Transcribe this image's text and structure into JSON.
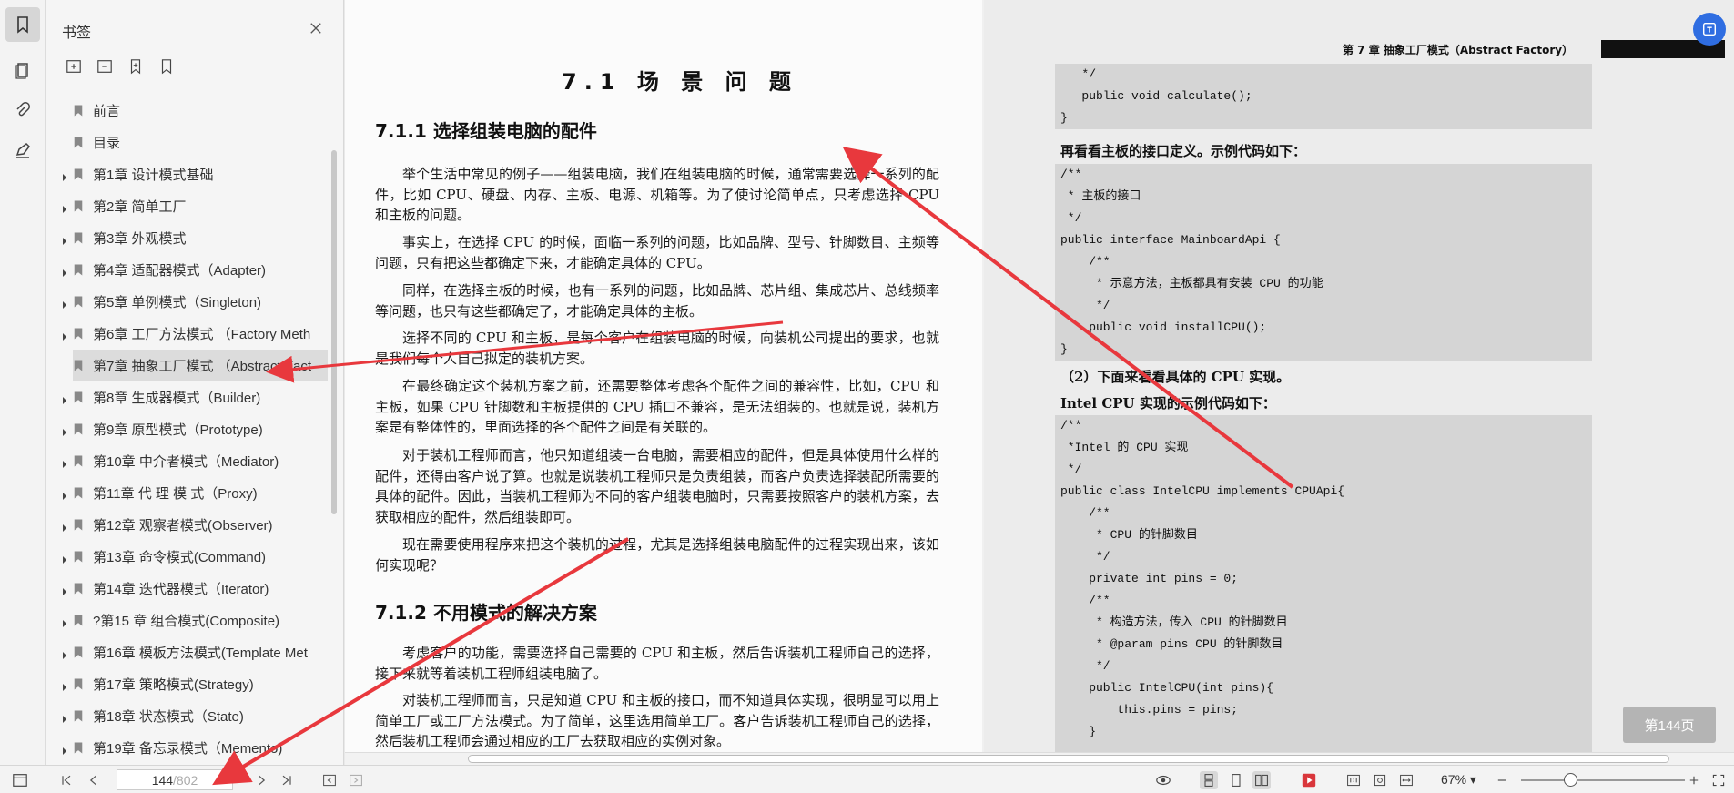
{
  "sidebar_panel": {
    "title": "书签",
    "items": [
      {
        "label": "前言",
        "expandable": false
      },
      {
        "label": "目录",
        "expandable": false
      },
      {
        "label": "第1章 设计模式基础",
        "expandable": true
      },
      {
        "label": "第2章 简单工厂",
        "expandable": true
      },
      {
        "label": "第3章 外观模式",
        "expandable": true
      },
      {
        "label": "第4章 适配器模式（Adapter)",
        "expandable": true
      },
      {
        "label": "第5章 单例模式（Singleton)",
        "expandable": true
      },
      {
        "label": "第6章 工厂方法模式 （Factory Meth",
        "expandable": true
      },
      {
        "label": "第7章 抽象工厂模式 （Abstract Fact",
        "expandable": true
      },
      {
        "label": "第8章 生成器模式（Builder)",
        "expandable": true
      },
      {
        "label": "第9章 原型模式（Prototype)",
        "expandable": true
      },
      {
        "label": "第10章 中介者模式（Mediator)",
        "expandable": true
      },
      {
        "label": "第11章 代 理 模 式（Proxy)",
        "expandable": true
      },
      {
        "label": "第12章 观察者模式(Observer)",
        "expandable": true
      },
      {
        "label": "第13章 命令模式(Command)",
        "expandable": true
      },
      {
        "label": "第14章 迭代器模式（Iterator)",
        "expandable": true
      },
      {
        "label": "?第15 章 组合模式(Composite)",
        "expandable": true
      },
      {
        "label": "第16章 模板方法模式(Template Met",
        "expandable": true
      },
      {
        "label": "第17章 策略模式(Strategy)",
        "expandable": true
      },
      {
        "label": "第18章 状态模式（State)",
        "expandable": true
      },
      {
        "label": "第19章 备忘录模式（Memento)",
        "expandable": true
      }
    ],
    "selected_index": 8
  },
  "document": {
    "left_page": {
      "section_title": "7.1  场 景 问 题",
      "sub1": "7.1.1   选择组装电脑的配件",
      "paragraphs1": [
        "举个生活中常见的例子——组装电脑，我们在组装电脑的时候，通常需要选择一系列的配件，比如 CPU、硬盘、内存、主板、电源、机箱等。为了使讨论简单点，只考虑选择 CPU 和主板的问题。",
        "事实上，在选择 CPU 的时候，面临一系列的问题，比如品牌、型号、针脚数目、主频等问题，只有把这些都确定下来，才能确定具体的 CPU。",
        "同样，在选择主板的时候，也有一系列的问题，比如品牌、芯片组、集成芯片、总线频率等问题，也只有这些都确定了，才能确定具体的主板。",
        "选择不同的 CPU 和主板，是每个客户在组装电脑的时候，向装机公司提出的要求，也就是我们每个人自己拟定的装机方案。",
        "在最终确定这个装机方案之前，还需要整体考虑各个配件之间的兼容性，比如，CPU 和主板，如果 CPU 针脚数和主板提供的 CPU 插口不兼容，是无法组装的。也就是说，装机方案是有整体性的，里面选择的各个配件之间是有关联的。",
        "对于装机工程师而言，他只知道组装一台电脑，需要相应的配件，但是具体使用什么样的配件，还得由客户说了算。也就是说装机工程师只是负责组装，而客户负责选择装配所需要的具体的配件。因此，当装机工程师为不同的客户组装电脑时，只需要按照客户的装机方案，去获取相应的配件，然后组装即可。",
        "现在需要使用程序来把这个装机的过程，尤其是选择组装电脑配件的过程实现出来，该如何实现呢？"
      ],
      "sub2": "7.1.2   不用模式的解决方案",
      "paragraphs2": [
        "考虑客户的功能，需要选择自己需要的 CPU 和主板，然后告诉装机工程师自己的选择，接下来就等着装机工程师组装电脑了。",
        "对装机工程师而言，只是知道 CPU 和主板的接口，而不知道具体实现，很明显可以用上简单工厂或工厂方法模式。为了简单，这里选用简单工厂。客户告诉装机工程师自己的选择，然后装机工程师会通过相应的工厂去获取相应的实例对象。"
      ]
    },
    "right_page": {
      "running_head": "第 7 章   抽象工厂模式（Abstract Factory）",
      "code1": [
        "   */",
        "   public void calculate();",
        "}"
      ],
      "text1": "再看看主板的接口定义。示例代码如下：",
      "code2": [
        "/**",
        " * 主板的接口",
        " */",
        "public interface MainboardApi {",
        "    /**",
        "     * 示意方法，主板都具有安装 CPU 的功能",
        "     */",
        "    public void installCPU();",
        "}"
      ],
      "text2": "（2）下面来看看具体的 CPU 实现。",
      "text3": "Intel CPU 实现的示例代码如下：",
      "code3": [
        "/**",
        " *Intel 的 CPU 实现",
        " */",
        "public class IntelCPU implements CPUApi{",
        "    /**",
        "     * CPU 的针脚数目",
        "     */",
        "    private int pins = 0;",
        "    /**",
        "     * 构造方法，传入 CPU 的针脚数目",
        "     * @param pins CPU 的针脚数目",
        "     */",
        "    public IntelCPU(int pins){",
        "        this.pins = pins;",
        "    }"
      ]
    },
    "page_badge": "第144页"
  },
  "status_bar": {
    "current_page": "144",
    "total_pages": "/802",
    "zoom": "67%",
    "zoom_level": 0.3
  },
  "colors": {
    "annotation_arrow": "#e8383d",
    "accent": "#2f6de1"
  }
}
